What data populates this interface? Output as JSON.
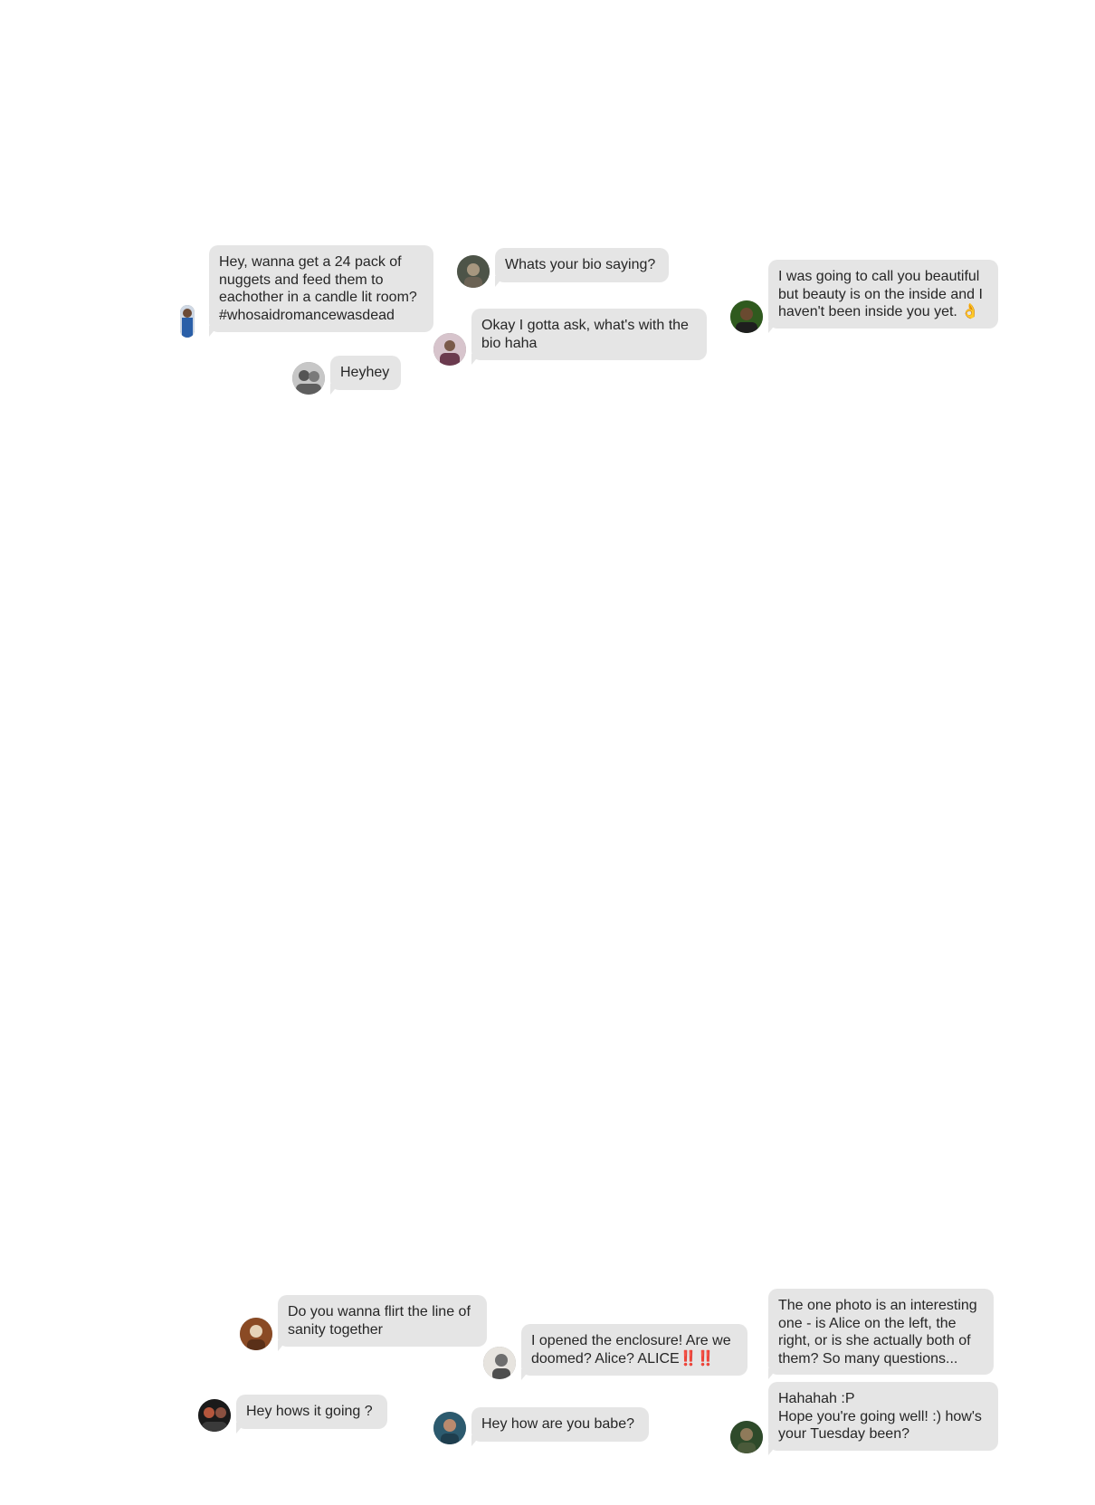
{
  "messages": [
    {
      "id": "nuggets",
      "text": "Hey, wanna get a 24 pack of nuggets and feed them to eachother in a candle lit room? #whosaidromancewasdead",
      "avatar": "person-photo",
      "colors": [
        "#2a5fa8",
        "#cfd8e4"
      ]
    },
    {
      "id": "bio-saying",
      "text": "Whats your bio saying?",
      "avatar": "person-photo",
      "colors": [
        "#4d5448",
        "#a7977f"
      ]
    },
    {
      "id": "beautiful",
      "text": "I was going to call you beautiful but beauty is on the inside and I haven't been inside you yet. ",
      "emoji": "👌",
      "avatar": "person-photo",
      "colors": [
        "#2f5a1e",
        "#6a4a30"
      ]
    },
    {
      "id": "bio-haha",
      "text": "Okay I gotta ask, what's with the bio haha",
      "avatar": "person-photo",
      "colors": [
        "#6b3a4e",
        "#d7c4cc"
      ]
    },
    {
      "id": "heyhey",
      "text": "Heyhey",
      "avatar": "person-photo",
      "colors": [
        "#555555",
        "#c7c7c7"
      ]
    },
    {
      "id": "flirt",
      "text": "Do you wanna flirt the line of sanity together",
      "avatar": "person-photo",
      "colors": [
        "#8a4a24",
        "#e6d3b8"
      ]
    },
    {
      "id": "enclosure",
      "text": "I opened the enclosure! Are we doomed? Alice? ALICE",
      "alarm": "‼️‼️",
      "avatar": "person-photo",
      "colors": [
        "#6e6e6e",
        "#e7e4df"
      ]
    },
    {
      "id": "alice-photo",
      "text": "The one photo is an interesting one - is Alice on the left, the right, or is she actually both of them? So many questions...",
      "avatar": null
    },
    {
      "id": "hows-it-going",
      "text": "Hey hows it going ?",
      "avatar": "person-photo",
      "colors": [
        "#1a1a1a",
        "#b5563c"
      ]
    },
    {
      "id": "babe",
      "text": "Hey how are you babe?",
      "avatar": "person-photo",
      "colors": [
        "#2c5a6e",
        "#b98a6e"
      ]
    },
    {
      "id": "tuesday",
      "text": "Hahahah :P\nHope you're going well! :) how's your Tuesday been?",
      "avatar": "person-photo",
      "colors": [
        "#2e4a2a",
        "#8f7a5a"
      ]
    }
  ]
}
